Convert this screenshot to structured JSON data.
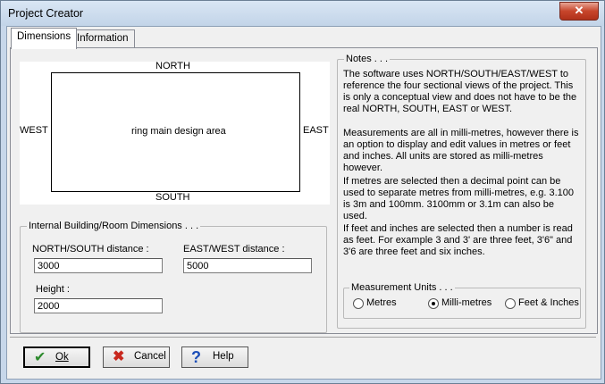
{
  "window": {
    "title": "Project Creator",
    "close_glyph": "✕"
  },
  "tabs": [
    {
      "label": "Dimensions",
      "active": true
    },
    {
      "label": "Information",
      "active": false
    }
  ],
  "diagram": {
    "north": "NORTH",
    "south": "SOUTH",
    "east": "EAST",
    "west": "WEST",
    "area_label": "ring main design area"
  },
  "dimensions": {
    "legend": "Internal Building/Room Dimensions . . .",
    "ns_label": "NORTH/SOUTH distance :",
    "ns_value": "3000",
    "ew_label": "EAST/WEST distance :",
    "ew_value": "5000",
    "height_label": "Height :",
    "height_value": "2000"
  },
  "notes": {
    "legend": "Notes . . .",
    "p1": "The software uses NORTH/SOUTH/EAST/WEST to reference the four sectional views of the project.  This is only a conceptual view and does not have to be the real NORTH, SOUTH, EAST or WEST.",
    "p2": "Measurements are all in milli-metres, however there is an option to display and edit values in metres or feet and inches.  All units are stored as milli-metres however.",
    "p3": "If metres are selected then a decimal point can be used to separate metres from milli-metres, e.g. 3.100 is 3m and 100mm. 3100mm or 3.1m can also be used.",
    "p4": "If feet and inches are selected then a number is read as feet.  For example 3 and 3' are three feet, 3'6\" and 3'6 are three feet and six inches."
  },
  "units": {
    "legend": "Measurement Units . . .",
    "options": [
      {
        "label": "Metres",
        "selected": false
      },
      {
        "label": "Milli-metres",
        "selected": true
      },
      {
        "label": "Feet & Inches",
        "selected": false
      }
    ]
  },
  "buttons": {
    "ok": {
      "label": "Ok",
      "icon": "check-icon",
      "color": "#2d8a2d"
    },
    "cancel": {
      "label": "Cancel",
      "icon": "x-icon",
      "color": "#c8281e"
    },
    "help": {
      "label": "Help",
      "icon": "question-icon",
      "color": "#1d4fb8"
    }
  }
}
